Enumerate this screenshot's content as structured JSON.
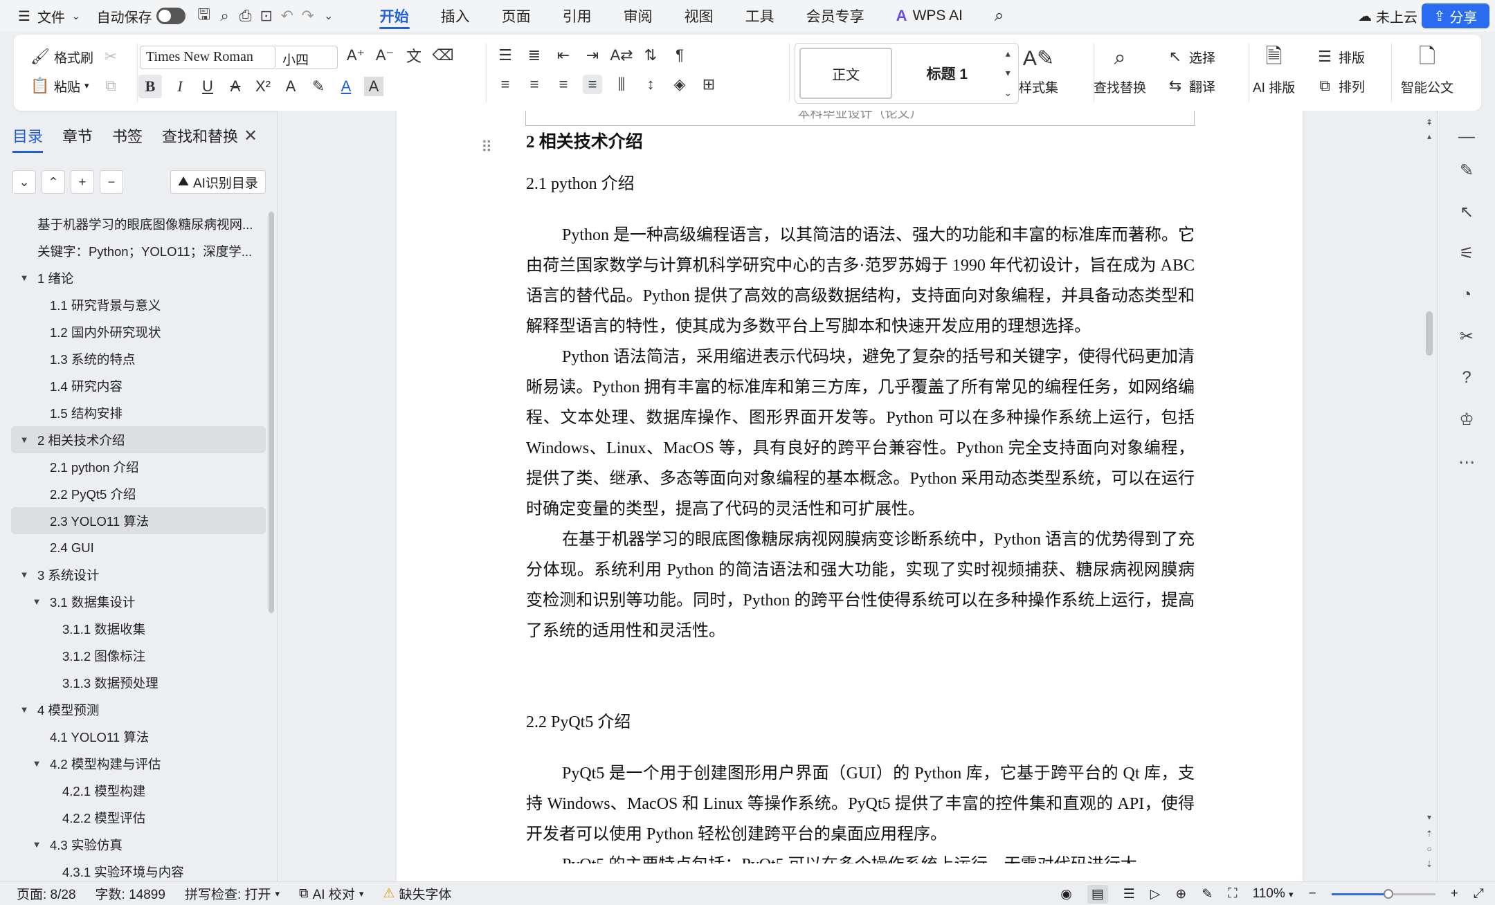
{
  "menubar": {
    "file_label": "文件",
    "autosave_label": "自动保存",
    "tabs": [
      "开始",
      "插入",
      "页面",
      "引用",
      "审阅",
      "视图",
      "工具",
      "会员专享"
    ],
    "active_tab": "开始",
    "wps_ai_label": "WPS AI",
    "cloud_label": "未上云",
    "share_label": "分享"
  },
  "ribbon": {
    "format_painter": "格式刷",
    "paste": "粘贴",
    "font_name": "Times New Roman",
    "font_size": "小四",
    "styles": [
      "正文",
      "标题 1"
    ],
    "style_set": "样式集",
    "find_replace": "查找替换",
    "select": "选择",
    "translate": "翻译",
    "ai_layout": "AI 排版",
    "layout": "排版",
    "arrange": "排列",
    "smart_doc": "智能公文"
  },
  "nav": {
    "tabs": [
      "目录",
      "章节",
      "书签",
      "查找和替换"
    ],
    "active_tab": "目录",
    "ai_toc_label": "AI识别目录",
    "items": [
      {
        "label": "基于机器学习的眼底图像糖尿病视网...",
        "level": 0,
        "caret": ""
      },
      {
        "label": "关键字：Python；YOLO11；深度学...",
        "level": 0,
        "caret": ""
      },
      {
        "label": "1  绪论",
        "level": 0,
        "caret": "▼"
      },
      {
        "label": "1.1 研究背景与意义",
        "level": 1,
        "caret": ""
      },
      {
        "label": "1.2 国内外研究现状",
        "level": 1,
        "caret": ""
      },
      {
        "label": "1.3 系统的特点",
        "level": 1,
        "caret": ""
      },
      {
        "label": "1.4 研究内容",
        "level": 1,
        "caret": ""
      },
      {
        "label": "1.5 结构安排",
        "level": 1,
        "caret": ""
      },
      {
        "label": "2  相关技术介绍",
        "level": 0,
        "caret": "▼",
        "selected": true
      },
      {
        "label": "2.1 python 介绍",
        "level": 1,
        "caret": ""
      },
      {
        "label": "2.2 PyQt5 介绍",
        "level": 1,
        "caret": ""
      },
      {
        "label": "2.3 YOLO11 算法",
        "level": 1,
        "caret": "",
        "selected": true
      },
      {
        "label": "2.4 GUI",
        "level": 1,
        "caret": ""
      },
      {
        "label": "3  系统设计",
        "level": 0,
        "caret": "▼"
      },
      {
        "label": "3.1  数据集设计",
        "level": 1,
        "caret": "▼"
      },
      {
        "label": "3.1.1 数据收集",
        "level": 2,
        "caret": ""
      },
      {
        "label": "3.1.2 图像标注",
        "level": 2,
        "caret": ""
      },
      {
        "label": "3.1.3 数据预处理",
        "level": 2,
        "caret": ""
      },
      {
        "label": "4  模型预测",
        "level": 0,
        "caret": "▼"
      },
      {
        "label": "4.1 YOLO11  算法",
        "level": 1,
        "caret": ""
      },
      {
        "label": "4.2  模型构建与评估",
        "level": 1,
        "caret": "▼"
      },
      {
        "label": "4.2.1 模型构建",
        "level": 2,
        "caret": ""
      },
      {
        "label": "4.2.2 模型评估",
        "level": 2,
        "caret": ""
      },
      {
        "label": "4.3  实验仿真",
        "level": 1,
        "caret": "▼"
      },
      {
        "label": "4.3.1  实验环境与内容",
        "level": 2,
        "caret": ""
      }
    ]
  },
  "document": {
    "header_text": "本科毕业设计（论文）",
    "chapter_title": "2  相关技术介绍",
    "section_1_title": "2.1 python 介绍",
    "section_1_paras": [
      "Python 是一种高级编程语言，以其简洁的语法、强大的功能和丰富的标准库而著称。它由荷兰国家数学与计算机科学研究中心的吉多·范罗苏姆于 1990 年代初设计，旨在成为 ABC 语言的替代品。Python 提供了高效的高级数据结构，支持面向对象编程，并具备动态类型和解释型语言的特性，使其成为多数平台上写脚本和快速开发应用的理想选择。",
      "Python 语法简洁，采用缩进表示代码块，避免了复杂的括号和关键字，使得代码更加清晰易读。Python 拥有丰富的标准库和第三方库，几乎覆盖了所有常见的编程任务，如网络编程、文本处理、数据库操作、图形界面开发等。Python 可以在多种操作系统上运行，包括 Windows、Linux、MacOS 等，具有良好的跨平台兼容性。Python 完全支持面向对象编程，提供了类、继承、多态等面向对象编程的基本概念。Python 采用动态类型系统，可以在运行时确定变量的类型，提高了代码的灵活性和可扩展性。",
      "在基于机器学习的眼底图像糖尿病视网膜病变诊断系统中，Python 语言的优势得到了充分体现。系统利用 Python 的简洁语法和强大功能，实现了实时视频捕获、糖尿病视网膜病变检测和识别等功能。同时，Python 的跨平台性使得系统可以在多种操作系统上运行，提高了系统的适用性和灵活性。"
    ],
    "section_2_title": "2.2 PyQt5 介绍",
    "section_2_paras": [
      "PyQt5 是一个用于创建图形用户界面（GUI）的 Python 库，它基于跨平台的 Qt 库，支持 Windows、MacOS 和 Linux 等操作系统。PyQt5 提供了丰富的控件集和直观的 API，使得开发者可以使用 Python 轻松创建跨平台的桌面应用程序。",
      "PyQt5 的主要特点包括：PyQt5 可以在多个操作系统上运行，无需对代码进行大"
    ]
  },
  "status": {
    "page": "页面: 8/28",
    "words": "字数: 14899",
    "spell": "拼写检查: 打开",
    "ai_check": "AI 校对",
    "missing_font": "缺失字体",
    "zoom": "110%",
    "zoom_fraction": 0.55
  }
}
